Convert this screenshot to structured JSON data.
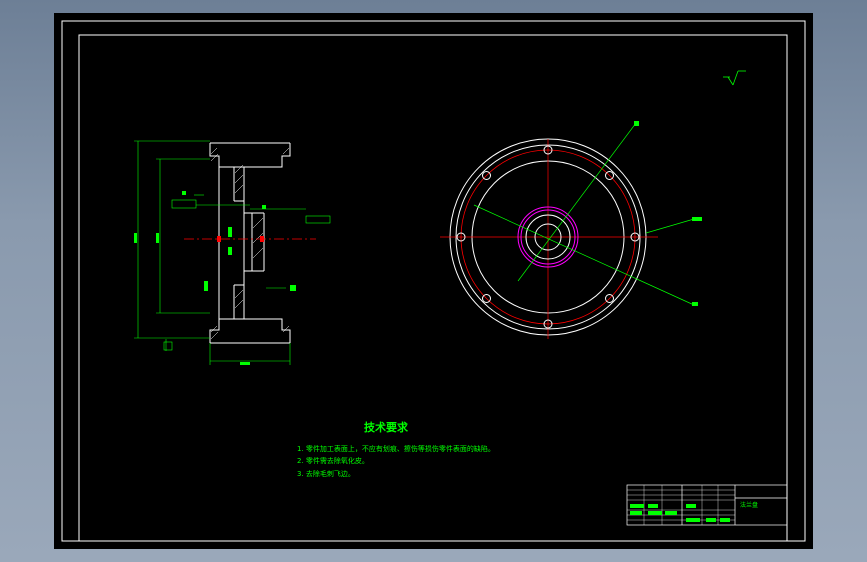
{
  "technical_requirements": {
    "heading": "技术要求",
    "items": [
      "1. 零件加工表面上，不应有划痕、擦伤等损伤零件表面的缺陷。",
      "2. 零件需去除氧化皮。",
      "3. 去除毛刺飞边。"
    ]
  },
  "title_block": {
    "part_name": "法兰盘"
  },
  "colors": {
    "background": "#000000",
    "frame": "#ffffff",
    "text": "#00ff00",
    "center_lines": "#ff0000",
    "hub": "#ff00ff",
    "dimension": "#00ff00"
  }
}
